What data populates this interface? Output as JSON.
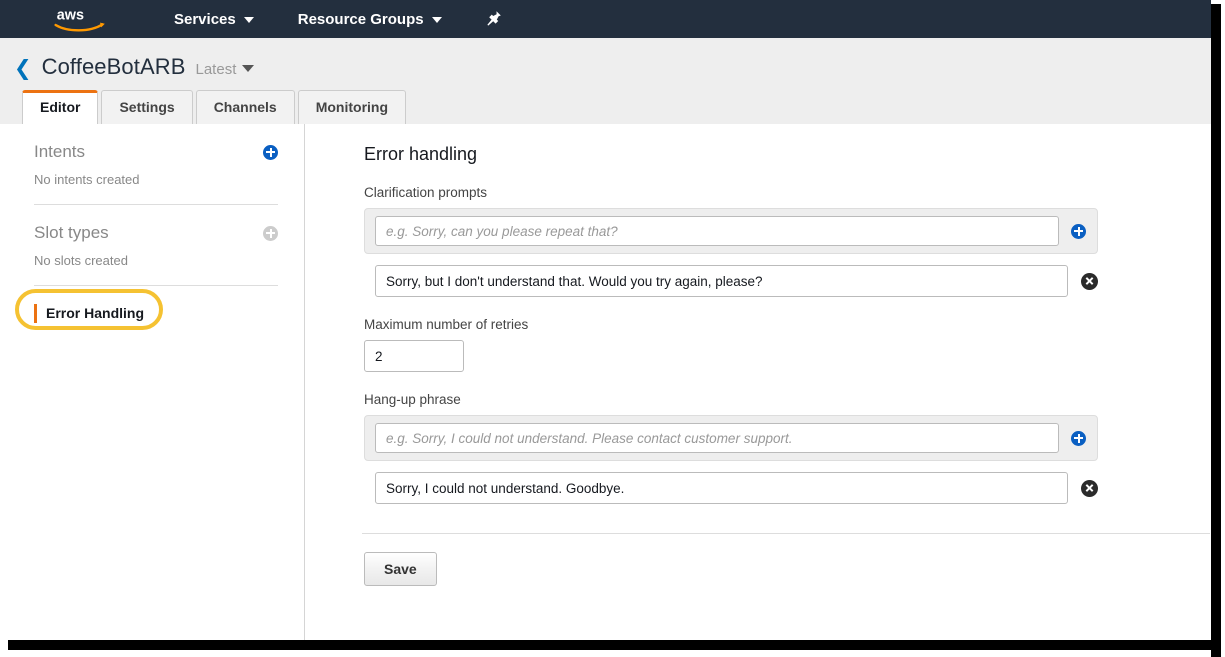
{
  "nav": {
    "logo": "aws-logo",
    "services_label": "Services",
    "resource_groups_label": "Resource Groups",
    "pin_icon": "pushpin-icon",
    "bg_color": "#232f3e"
  },
  "header": {
    "back_icon": "back-chevron-icon",
    "bot_name": "CoffeeBotARB",
    "version": "Latest",
    "accent_color": "#ec7211"
  },
  "tabs": [
    {
      "label": "Editor",
      "active": true
    },
    {
      "label": "Settings",
      "active": false
    },
    {
      "label": "Channels",
      "active": false
    },
    {
      "label": "Monitoring",
      "active": false
    }
  ],
  "sidebar": {
    "intents": {
      "title": "Intents",
      "empty_text": "No intents created",
      "add_icon": "plus-circle-icon"
    },
    "slot_types": {
      "title": "Slot types",
      "empty_text": "No slots created",
      "add_icon": "plus-circle-icon"
    },
    "error_handling": {
      "label": "Error Handling",
      "selected": true,
      "highlight_color": "#f5c232"
    }
  },
  "main": {
    "title": "Error handling",
    "clarification_prompts": {
      "label": "Clarification prompts",
      "new_value": "",
      "placeholder": "e.g. Sorry, can you please repeat that?",
      "add_icon": "plus-circle-icon",
      "values": [
        {
          "text": "Sorry, but I don't understand that. Would you try again, please?",
          "remove_icon": "close-circle-icon"
        }
      ]
    },
    "max_retries": {
      "label": "Maximum number of retries",
      "value": "2"
    },
    "hangup_phrase": {
      "label": "Hang-up phrase",
      "new_value": "",
      "placeholder": "e.g. Sorry, I could not understand. Please contact customer support.",
      "add_icon": "plus-circle-icon",
      "values": [
        {
          "text": "Sorry, I could not understand. Goodbye.",
          "remove_icon": "close-circle-icon"
        }
      ]
    },
    "save_label": "Save"
  }
}
